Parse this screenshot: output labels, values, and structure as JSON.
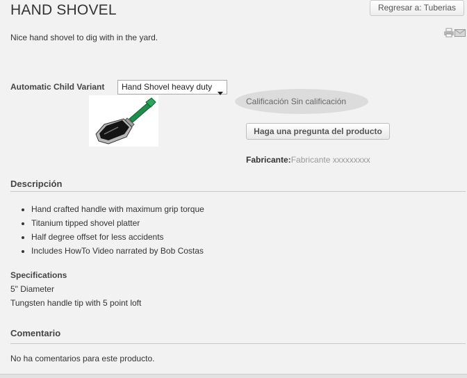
{
  "product": {
    "title": "HAND SHOVEL",
    "intro": "Nice hand shovel to dig with in the yard."
  },
  "nav": {
    "back_label": "Regresar a: Tuberias"
  },
  "tools": {
    "print_icon": "printer-icon",
    "email_icon": "envelope-icon"
  },
  "variant": {
    "label": "Automatic Child Variant",
    "selected": "Hand Shovel heavy duty"
  },
  "rating": {
    "text": "Calificación Sin calificación"
  },
  "ask": {
    "label": "Haga una pregunta del producto"
  },
  "manufacturer": {
    "label": "Fabricante:",
    "value": "Fabricante xxxxxxxxx"
  },
  "description": {
    "title": "Descripción",
    "items": [
      "Hand crafted handle with maximum grip torque",
      "Titanium tipped shovel platter",
      "Half degree offset for less accidents",
      "Includes HowTo Video narrated by Bob Costas"
    ]
  },
  "specifications": {
    "title": "Specifications",
    "lines": [
      "5\" Diameter",
      "Tungsten handle tip with 5 point loft"
    ]
  },
  "reviews": {
    "title": "Comentario",
    "empty_text": "No ha comentarios para este producto."
  },
  "colors": {
    "handle": "#1e8f4a",
    "blade": "#1a1a1a",
    "page_bg": "#f2f2f2"
  }
}
